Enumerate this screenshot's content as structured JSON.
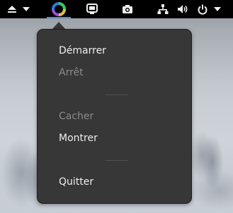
{
  "topbar": {
    "eject_icon": "eject-icon",
    "dropdown_icon": "chevron-down-icon",
    "app_icon": "circular-app-icon",
    "window_icon": "screen-icon",
    "camera_icon": "camera-icon",
    "network_icon": "network-icon",
    "volume_icon": "volume-icon",
    "power_icon": "power-icon",
    "power_dropdown_icon": "chevron-down-icon",
    "accent_color": "#4a90d9"
  },
  "menu": {
    "start_label": "Démarrer",
    "stop_label": "Arrêt",
    "hide_label": "Cacher",
    "show_label": "Montrer",
    "quit_label": "Quitter"
  }
}
